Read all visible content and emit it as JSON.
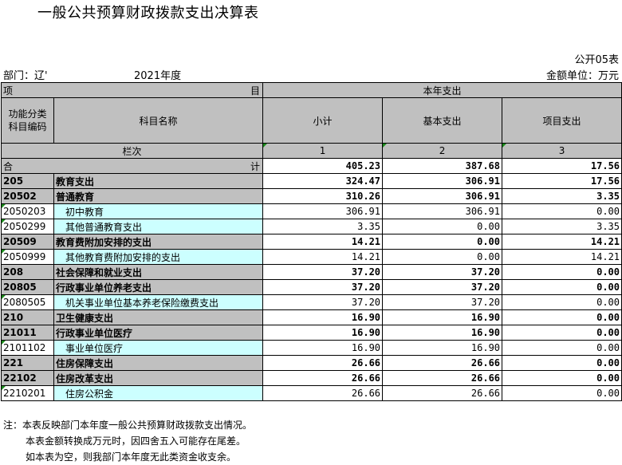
{
  "header": {
    "title": "一般公共预算财政拨款支出决算表",
    "form_no": "公开05表",
    "dept": "部门：辽'",
    "year": "2021年度",
    "unit": "金额单位：万元"
  },
  "table": {
    "h_item": "项",
    "h_mu": "目",
    "h_spending": "本年支出",
    "h_code": "功能分类\n科目编码",
    "h_name": "科目名称",
    "h_subtotal": "小计",
    "h_basic": "基本支出",
    "h_project": "项目支出",
    "h_lanci": "栏次",
    "col_nums": [
      "1",
      "2",
      "3"
    ],
    "total_label_left": "合",
    "total_label_right": "计",
    "total_values": [
      "405.23",
      "387.68",
      "17.56"
    ],
    "rows": [
      {
        "level": 1,
        "code": "205",
        "name": "教育支出",
        "values": [
          "324.47",
          "306.91",
          "17.56"
        ]
      },
      {
        "level": 2,
        "code": "20502",
        "name": "普通教育",
        "values": [
          "310.26",
          "306.91",
          "3.35"
        ]
      },
      {
        "level": 3,
        "code": "2050203",
        "name": "初中教育",
        "values": [
          "306.91",
          "306.91",
          "0.00"
        ]
      },
      {
        "level": 3,
        "code": "2050299",
        "name": "其他普通教育支出",
        "values": [
          "3.35",
          "0.00",
          "3.35"
        ]
      },
      {
        "level": 2,
        "code": "20509",
        "name": "教育费附加安排的支出",
        "values": [
          "14.21",
          "0.00",
          "14.21"
        ]
      },
      {
        "level": 3,
        "code": "2050999",
        "name": "其他教育费附加安排的支出",
        "values": [
          "14.21",
          "0.00",
          "14.21"
        ]
      },
      {
        "level": 1,
        "code": "208",
        "name": "社会保障和就业支出",
        "values": [
          "37.20",
          "37.20",
          "0.00"
        ]
      },
      {
        "level": 2,
        "code": "20805",
        "name": "行政事业单位养老支出",
        "values": [
          "37.20",
          "37.20",
          "0.00"
        ]
      },
      {
        "level": 3,
        "code": "2080505",
        "name": "机关事业单位基本养老保险缴费支出",
        "values": [
          "37.20",
          "37.20",
          "0.00"
        ]
      },
      {
        "level": 1,
        "code": "210",
        "name": "卫生健康支出",
        "values": [
          "16.90",
          "16.90",
          "0.00"
        ]
      },
      {
        "level": 2,
        "code": "21011",
        "name": "行政事业单位医疗",
        "values": [
          "16.90",
          "16.90",
          "0.00"
        ]
      },
      {
        "level": 3,
        "code": "2101102",
        "name": "事业单位医疗",
        "values": [
          "16.90",
          "16.90",
          "0.00"
        ]
      },
      {
        "level": 1,
        "code": "221",
        "name": "住房保障支出",
        "values": [
          "26.66",
          "26.66",
          "0.00"
        ]
      },
      {
        "level": 2,
        "code": "22102",
        "name": "住房改革支出",
        "values": [
          "26.66",
          "26.66",
          "0.00"
        ]
      },
      {
        "level": 3,
        "code": "2210201",
        "name": "住房公积金",
        "values": [
          "26.66",
          "26.66",
          "0.00"
        ]
      }
    ]
  },
  "notes": [
    "注：本表反映部门本年度一般公共预算财政拨款支出情况。",
    "本表金额转换成万元时，因四舍五入可能存在尾差。",
    "如本表为空，则我部门本年度无此类资金收支余。"
  ]
}
